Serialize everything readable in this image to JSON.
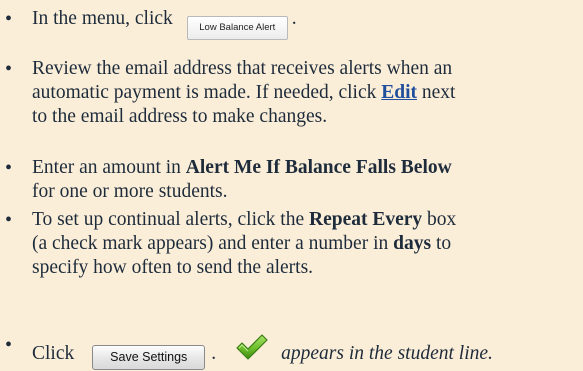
{
  "steps": [
    {
      "before": "In the menu, click",
      "button": "Low Balance Alert",
      "after": "."
    },
    {
      "line1": "Review the email address that receives alerts when an",
      "line2": "automatic payment is made. If needed, click",
      "link": "Edit",
      "line2_after": " next",
      "line3": "to the email address to make changes."
    },
    {
      "line1_before": "Enter an amount in ",
      "line1_bold": "Alert Me If Balance Falls Below",
      "line2": "for one or more students."
    },
    {
      "line1_before": "To set up continual alerts, click the ",
      "line1_bold": "Repeat Every",
      "line1_after": " box",
      "line2_before": "(a check mark appears) and enter a number in ",
      "line2_bold": "days",
      "line2_after": " to",
      "line3": "specify how often to send the alerts."
    },
    {
      "before": "Click",
      "button": "Save Settings",
      "after": ".",
      "result": "appears in the student line.",
      "icon": "checkmark-icon"
    }
  ],
  "colors": {
    "background": "#FBEED9",
    "text": "#1d2b3a",
    "link": "#1f4e9c",
    "check": "#6cbf2a"
  }
}
